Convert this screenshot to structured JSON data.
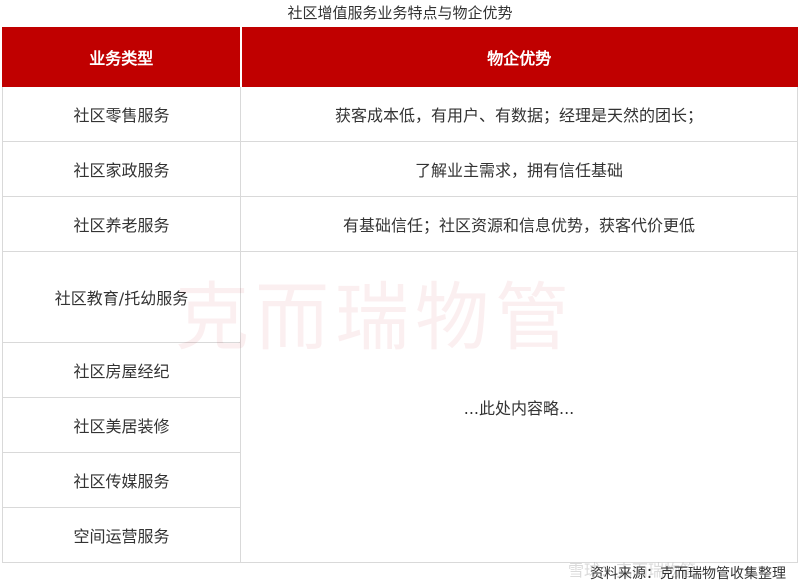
{
  "title": "社区增值服务业务特点与物企优势",
  "table": {
    "headers": [
      "业务类型",
      "物企优势"
    ],
    "rows": [
      {
        "type": "社区零售服务",
        "advantage": "获客成本低，有用户、有数据；经理是天然的团长；"
      },
      {
        "type": "社区家政服务",
        "advantage": "了解业主需求，拥有信任基础"
      },
      {
        "type": "社区养老服务",
        "advantage": "有基础信任；社区资源和信息优势，获客代价更低"
      },
      {
        "type": "社区教育/托幼服务",
        "advantage": "...此处内容略..."
      },
      {
        "type": "社区房屋经纪",
        "advantage": ""
      },
      {
        "type": "社区美居装修",
        "advantage": ""
      },
      {
        "type": "社区传媒服务",
        "advantage": ""
      },
      {
        "type": "空间运营服务",
        "advantage": ""
      }
    ]
  },
  "watermark": "克而瑞物管",
  "source": "资料来源：克而瑞物管收集整理",
  "brand_mark": "雪球：克而瑞物管"
}
